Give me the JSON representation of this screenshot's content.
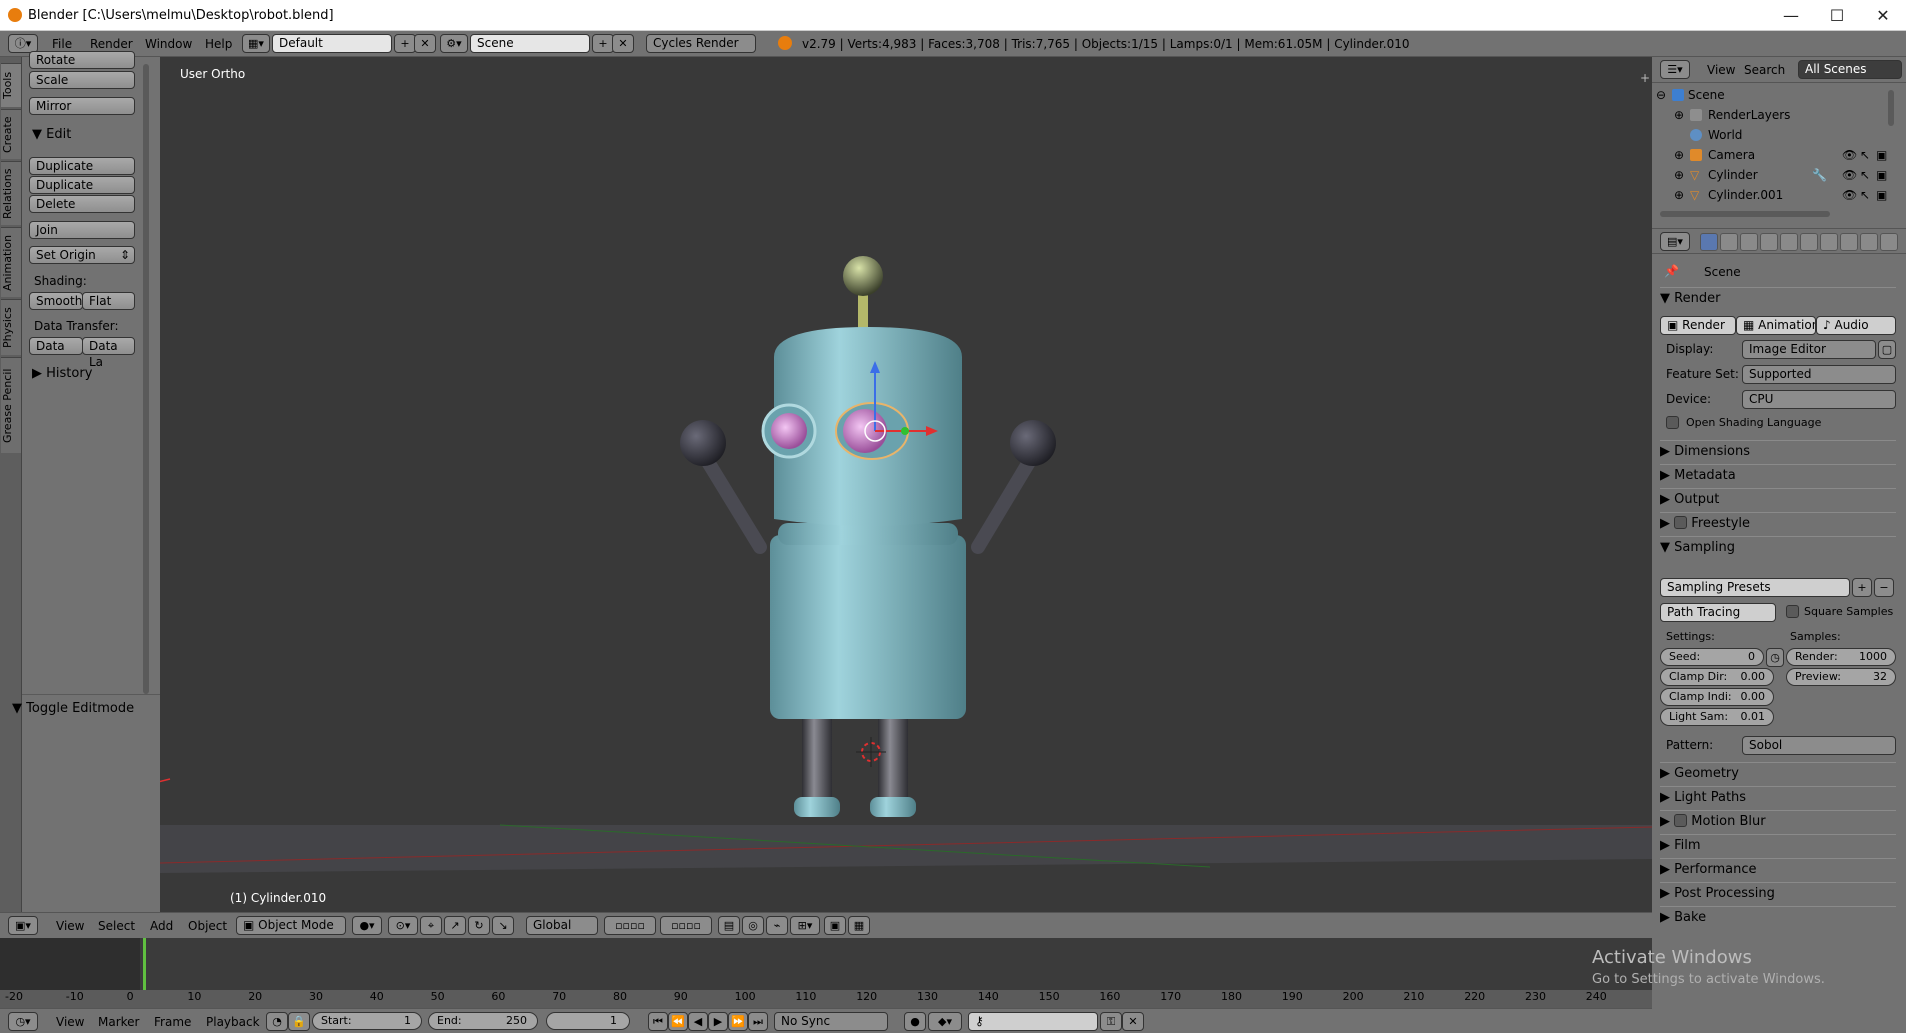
{
  "window": {
    "title": "Blender [C:\\Users\\melmu\\Desktop\\robot.blend]",
    "minimize": "—",
    "maximize": "☐",
    "close": "✕"
  },
  "info_header": {
    "menus": [
      "File",
      "Render",
      "Window",
      "Help"
    ],
    "screen_layout": "Default",
    "scene": "Scene",
    "render_engine": "Cycles Render",
    "stats": "v2.79 | Verts:4,983 | Faces:3,708 | Tris:7,765 | Objects:1/15 | Lamps:0/1 | Mem:61.05M | Cylinder.010"
  },
  "tool_tabs": [
    "Tools",
    "Create",
    "Relations",
    "Animation",
    "Physics",
    "Grease Pencil"
  ],
  "tool_shelf": {
    "buttons_top": [
      "Rotate",
      "Scale",
      "Mirror"
    ],
    "edit_header": "Edit",
    "edit_buttons": [
      "Duplicate",
      "Duplicate Linked",
      "Delete"
    ],
    "join": "Join",
    "set_origin": "Set Origin",
    "shading_label": "Shading:",
    "smooth": "Smooth",
    "flat": "Flat",
    "data_transfer_label": "Data Transfer:",
    "data": "Data",
    "data_layout": "Data La",
    "history": "History",
    "toggle_editmode": "Toggle Editmode"
  },
  "viewport": {
    "view_label": "User Ortho",
    "object_label": "(1) Cylinder.010",
    "colors": {
      "background": "#393939",
      "robot_body": "#7fb3bd",
      "eyes": "#d98fd9",
      "limbs": "#4a4a52"
    }
  },
  "view3d_header": {
    "menus": [
      "View",
      "Select",
      "Add",
      "Object"
    ],
    "mode": "Object Mode",
    "orientation": "Global"
  },
  "outliner": {
    "menus": [
      "View",
      "Search"
    ],
    "filter": "All Scenes",
    "items": [
      {
        "label": "Scene",
        "icon": "scene-icon"
      },
      {
        "label": "RenderLayers",
        "icon": "render-layers-icon"
      },
      {
        "label": "World",
        "icon": "world-icon"
      },
      {
        "label": "Camera",
        "icon": "camera-icon"
      },
      {
        "label": "Cylinder",
        "icon": "mesh-icon"
      },
      {
        "label": "Cylinder.001",
        "icon": "mesh-icon"
      }
    ]
  },
  "properties": {
    "context": "Scene",
    "render_header": "Render",
    "render_btn": "Render",
    "animation_btn": "Animation",
    "audio_btn": "Audio",
    "display_label": "Display:",
    "display_value": "Image Editor",
    "feature_label": "Feature Set:",
    "feature_value": "Supported",
    "device_label": "Device:",
    "device_value": "CPU",
    "osl": "Open Shading Language",
    "panels_a": [
      "Dimensions",
      "Metadata",
      "Output",
      "Freestyle"
    ],
    "sampling": "Sampling",
    "sampling_presets": "Sampling Presets",
    "integrator": "Path Tracing",
    "square_samples": "Square Samples",
    "settings_label": "Settings:",
    "samples_label": "Samples:",
    "seed": "Seed:",
    "seed_val": "0",
    "clamp_dir": "Clamp Dir:",
    "clamp_dir_val": "0.00",
    "clamp_ind": "Clamp Indi:",
    "clamp_ind_val": "0.00",
    "light_sam": "Light Sam:",
    "light_sam_val": "0.01",
    "render_s": "Render:",
    "render_s_val": "1000",
    "preview_s": "Preview:",
    "preview_s_val": "32",
    "pattern_label": "Pattern:",
    "pattern_value": "Sobol",
    "panels_b": [
      "Geometry",
      "Light Paths",
      "Motion Blur",
      "Film",
      "Performance",
      "Post Processing",
      "Bake"
    ]
  },
  "timeline": {
    "ticks": [
      "-20",
      "-10",
      "0",
      "10",
      "20",
      "30",
      "40",
      "50",
      "60",
      "70",
      "80",
      "90",
      "100",
      "110",
      "120",
      "130",
      "140",
      "150",
      "160",
      "170",
      "180",
      "190",
      "200",
      "210",
      "220",
      "230",
      "240"
    ],
    "menus": [
      "View",
      "Marker",
      "Frame",
      "Playback"
    ],
    "start_label": "Start:",
    "start_val": "1",
    "end_label": "End:",
    "end_val": "250",
    "current": "1",
    "sync": "No Sync"
  },
  "watermark": {
    "line1": "Activate Windows",
    "line2": "Go to Settings to activate Windows."
  }
}
